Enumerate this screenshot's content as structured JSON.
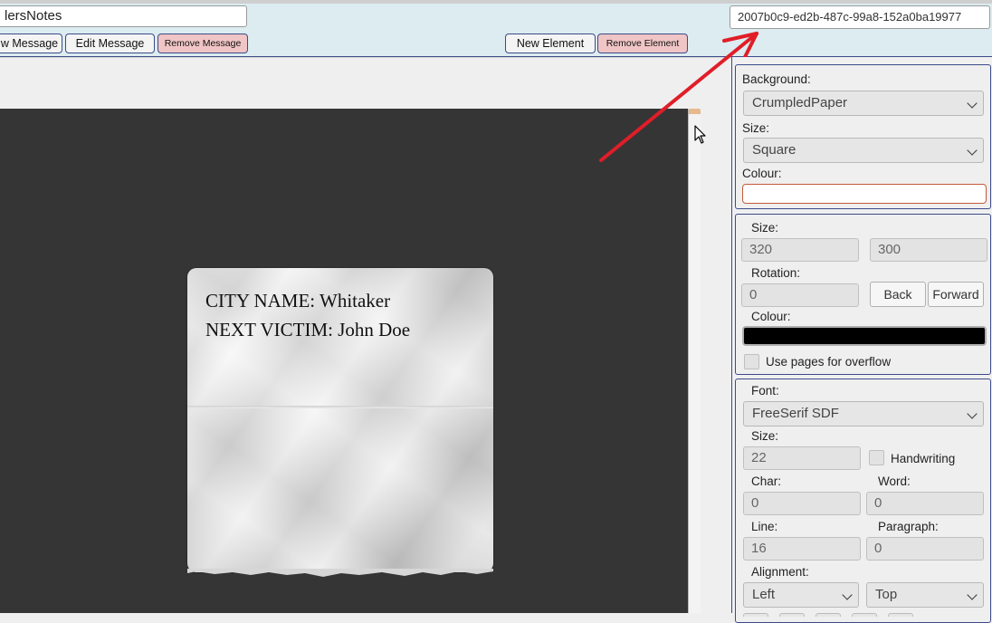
{
  "toolbar": {
    "note_name": "lersNotes",
    "element_id": "2007b0c9-ed2b-487c-99a8-152a0ba19977",
    "new_message_label": "w Message",
    "edit_message_label": "Edit Message",
    "remove_message_label": "Remove Message",
    "new_element_label": "New Element",
    "remove_element_label": "Remove Element"
  },
  "note": {
    "lines": [
      "CITY NAME: Whitaker",
      "NEXT VICTIM: John Doe"
    ]
  },
  "background_panel": {
    "background_label": "Background:",
    "background_value": "CrumpledPaper",
    "size_label": "Size:",
    "size_value": "Square",
    "colour_label": "Colour:",
    "colour_value": "#ffffff"
  },
  "element_panel": {
    "size_label": "Size:",
    "width": "320",
    "height": "300",
    "rotation_label": "Rotation:",
    "rotation": "0",
    "back_label": "Back",
    "forward_label": "Forward",
    "colour_label": "Colour:",
    "colour_value": "#000000",
    "overflow_label": "Use pages for overflow"
  },
  "font_panel": {
    "font_label": "Font:",
    "font_value": "FreeSerif SDF",
    "size_label": "Size:",
    "size_value": "22",
    "handwriting_label": "Handwriting",
    "char_label": "Char:",
    "char_value": "0",
    "word_label": "Word:",
    "word_value": "0",
    "line_label": "Line:",
    "line_value": "16",
    "paragraph_label": "Paragraph:",
    "paragraph_value": "0",
    "alignment_label": "Alignment:",
    "align_h": "Left",
    "align_v": "Top"
  },
  "colors": {
    "accent_border": "#3d4a8a",
    "danger_button": "#f0c5c5",
    "canvas_bg": "#363536",
    "annotation_arrow": "#e01e28"
  },
  "icons": {
    "cursor": "mouse-pointer-icon",
    "dropdown": "chevron-down-icon",
    "annotation": "red-arrow-annotation"
  }
}
